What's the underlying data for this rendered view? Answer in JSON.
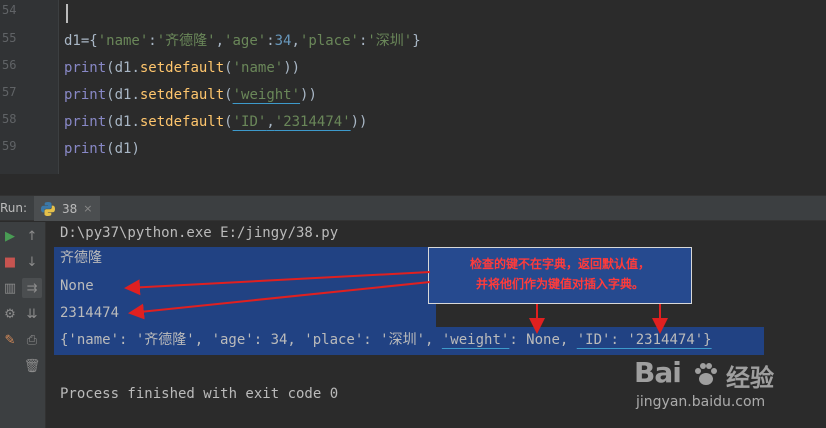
{
  "editor": {
    "line_numbers": [
      "54",
      "55",
      "56",
      "57",
      "58",
      "59"
    ],
    "lines": {
      "l55": {
        "var": "d1",
        "eq": "={",
        "k1": "'name'",
        "c1": ":",
        "v1": "'齐德隆'",
        "s1": ",",
        "k2": "'age'",
        "c2": ":",
        "v2": "34",
        "s2": ",",
        "k3": "'place'",
        "c3": ":",
        "v3": "'深圳'",
        "end": "}"
      },
      "l56": {
        "print": "print",
        "open": "(d1.",
        "method": "setdefault",
        "paren": "(",
        "arg1": "'name'",
        "close": "))"
      },
      "l57": {
        "print": "print",
        "open": "(d1.",
        "method": "setdefault",
        "paren": "(",
        "arg1": "'weight'",
        "close": "))"
      },
      "l58": {
        "print": "print",
        "open": "(d1.",
        "method": "setdefault",
        "paren": "(",
        "arg1": "'ID'",
        "comma": ",",
        "arg2": "'2314474'",
        "close": "))"
      },
      "l59": {
        "print": "print",
        "rest": "(d1)"
      }
    }
  },
  "run": {
    "label": "Run:",
    "tab_label": "38",
    "tab_close": "×"
  },
  "console": {
    "command": "D:\\py37\\python.exe E:/jingy/38.py",
    "out1": "齐德隆",
    "out2": "None",
    "out3": "2314474",
    "out4": {
      "a": "{'name': '齐德隆', 'age': 34, 'place': '深圳', ",
      "b": "'weight'",
      "c": ": None, ",
      "d": "'ID'",
      "e": ": '2314474'}"
    },
    "exit_msg": "Process finished with exit code 0"
  },
  "annotation": {
    "line1": "检查的键不在字典，返回默认值，",
    "line2": "并将他们作为键值对插入字典。"
  },
  "watermark": {
    "logo": "Bai",
    "logo_suffix": "经验",
    "url": "jingyan.baidu.com"
  },
  "colors": {
    "editor_bg": "#2b2b2b",
    "string": "#6a8759",
    "number": "#6897bb",
    "builtin": "#8888c6",
    "method": "#ffc66d",
    "selection": "#214283",
    "annotation_text": "#ff3b3b",
    "arrow": "#e02020"
  }
}
